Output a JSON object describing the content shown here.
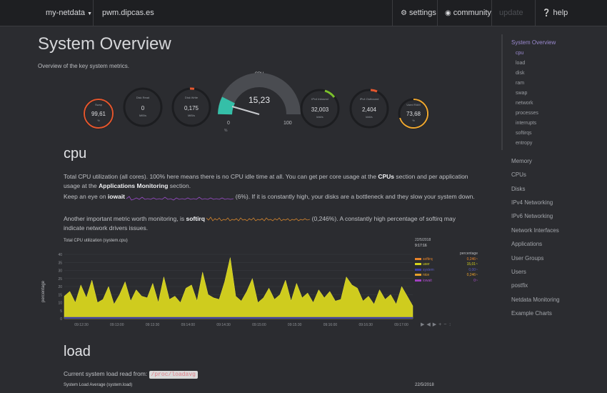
{
  "nav": {
    "menu_label": "my-netdata",
    "hostname": "pwm.dipcas.es",
    "settings": "settings",
    "community": "community",
    "update": "update",
    "help": "help"
  },
  "header": {
    "title": "System Overview",
    "subtitle": "Overview of the key system metrics."
  },
  "gauges": {
    "cpu_title": "CPU",
    "cpu_value": "15,23",
    "cpu_min": "0",
    "cpu_max": "100",
    "cpu_unit": "%",
    "items": [
      {
        "label": "Swap",
        "value": "99,61",
        "unit": "%"
      },
      {
        "label": "Disk Read",
        "value": "0",
        "unit": "MiB/s"
      },
      {
        "label": "Disk Write",
        "value": "0,175",
        "unit": "MiB/s"
      },
      {
        "label": "IPv4 Inbound",
        "value": "32,003",
        "unit": "kbit/s"
      },
      {
        "label": "IPv4 Outbound",
        "value": "2,404",
        "unit": "kbit/s"
      },
      {
        "label": "Used RAM",
        "value": "73,68",
        "unit": "%"
      }
    ]
  },
  "cpu_section": {
    "heading": "cpu",
    "p1_a": "Total CPU utilization (all cores). 100% here means there is no CPU idle time at all. You can get per core usage at the ",
    "p1_link1": "CPUs",
    "p1_b": " section and per application usage at the ",
    "p1_link2": "Applications Monitoring",
    "p1_c": " section.",
    "p2_a": "Keep an eye on ",
    "p2_key": "iowait",
    "p2_b": " (",
    "p2_val": "6%",
    "p2_c": "). If it is constantly high, your disks are a bottleneck and they slow your system down.",
    "p3_a": "Another important metric worth monitoring, is ",
    "p3_key": "softirq",
    "p3_b": " (",
    "p3_val": "0,246%",
    "p3_c": "). A constantly high percentage of softirq may indicate network drivers issues."
  },
  "cpu_chart": {
    "title": "Total CPU utilization (system.cpu)",
    "ylabel": "percentage",
    "date": "22/5/2018",
    "time": "9:17:16",
    "units": "percentage",
    "legend": [
      {
        "name": "softirq",
        "value": "0,246~",
        "color": "#e8842a"
      },
      {
        "name": "user",
        "value": "15,01~",
        "color": "#d6d41c"
      },
      {
        "name": "system",
        "value": "0,00~",
        "color": "#3d3fa8"
      },
      {
        "name": "nice",
        "value": "0,246~",
        "color": "#e8a02a"
      },
      {
        "name": "iowait",
        "value": "0~",
        "color": "#a040c0"
      }
    ]
  },
  "chart_data": {
    "type": "area",
    "x": [
      "09:12:30",
      "09:13:00",
      "09:13:30",
      "09:14:00",
      "09:14:30",
      "09:15:00",
      "09:15:30",
      "09:16:00",
      "09:16:30",
      "09:17:00"
    ],
    "ylabel": "percentage",
    "ylim": [
      0,
      40
    ],
    "yticks": [
      "40",
      "35",
      "30",
      "25",
      "20",
      "15",
      "10",
      "5",
      "0"
    ],
    "series": [
      {
        "name": "user",
        "values": [
          13,
          16,
          9,
          20,
          12,
          23,
          9,
          11,
          19,
          8,
          14,
          22,
          10,
          17,
          13,
          12,
          21,
          9,
          25,
          11,
          13,
          9,
          18,
          20,
          10,
          28,
          14,
          12,
          11,
          22,
          37,
          13,
          10,
          16,
          24,
          9,
          12,
          18,
          11,
          14,
          23,
          10,
          21,
          12,
          15,
          9,
          17,
          12,
          16,
          10,
          11,
          25,
          20,
          18,
          10,
          13,
          8,
          17,
          11,
          14,
          8,
          19,
          13,
          7
        ]
      },
      {
        "name": "system",
        "values": [
          1,
          1,
          1,
          1,
          1,
          1,
          1,
          1,
          1,
          1,
          1,
          1,
          1,
          1,
          1,
          1,
          1,
          1,
          1,
          1,
          1,
          1,
          1,
          1,
          1,
          1,
          1,
          1,
          1,
          1,
          1,
          1,
          1,
          1,
          1,
          1,
          1,
          1,
          1,
          1,
          1,
          1,
          1,
          1,
          1,
          1,
          1,
          1,
          1,
          1,
          1,
          1,
          1,
          1,
          1,
          1,
          1,
          1,
          1,
          1,
          1,
          1,
          1,
          1
        ]
      }
    ]
  },
  "load_section": {
    "heading": "load",
    "p1": "Current system load read from: ",
    "code": "/proc/loadavg",
    "chart_title": "System Load Average (system.load)",
    "date": "22/5/2018"
  },
  "sidebar": {
    "overview": "System Overview",
    "subs": [
      "cpu",
      "load",
      "disk",
      "ram",
      "swap",
      "network",
      "processes",
      "interrupts",
      "softirqs",
      "entropy"
    ],
    "items": [
      "Memory",
      "CPUs",
      "Disks",
      "IPv4 Networking",
      "IPv6 Networking",
      "Network Interfaces",
      "Applications",
      "User Groups",
      "Users",
      "postfix",
      "Netdata Monitoring",
      "Example Charts"
    ]
  }
}
